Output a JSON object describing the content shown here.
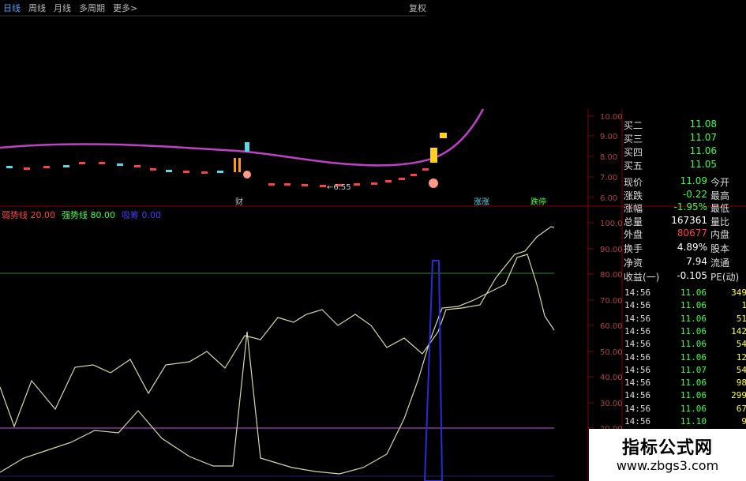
{
  "toolbar": {
    "tabs": [
      "日线",
      "周线",
      "月线",
      "多周期",
      "更多>"
    ],
    "active_tab": "日线",
    "restore_label": "复权"
  },
  "colors": {
    "ma_line": "#c040c8",
    "indicator_line": "#d8d8a8",
    "blue_spike": "#2a2ad8",
    "green_level": "#2a8a2a",
    "purple_level": "#a040c0",
    "axis_red": "#800000",
    "up": "#ff4040",
    "down": "#40ff40",
    "label_white": "#dddddd"
  },
  "price_axis": [
    "10.00",
    "9.00",
    "8.00",
    "7.00",
    "6.00"
  ],
  "indicator_axis": [
    "100.0",
    "90.00",
    "80.00",
    "70.00",
    "60.00",
    "50.00",
    "40.00",
    "30.00",
    "20.00"
  ],
  "price_marker": "6.55",
  "event_labels": [
    "财",
    "涨涨",
    "跌停"
  ],
  "legend": [
    {
      "label": "弱势线 20.00",
      "color": "#ff4040"
    },
    {
      "label": "强势线 80.00",
      "color": "#40ff40"
    },
    {
      "label": "吸筹 0.00",
      "color": "#4040ff"
    }
  ],
  "quote_panel": {
    "order_book": [
      {
        "label": "买二",
        "value": "11.08"
      },
      {
        "label": "买三",
        "value": "11.07"
      },
      {
        "label": "买四",
        "value": "11.06"
      },
      {
        "label": "买五",
        "value": "11.05"
      }
    ],
    "stats": [
      {
        "label": "现价",
        "value": "11.09",
        "label2": "今开",
        "color": "#40ff40"
      },
      {
        "label": "涨跌",
        "value": "-0.22",
        "label2": "最高",
        "color": "#40ff40"
      },
      {
        "label": "涨幅",
        "value": "-1.95%",
        "label2": "最低",
        "color": "#40ff40"
      },
      {
        "label": "总量",
        "value": "167361",
        "label2": "量比",
        "color": "#ffffff"
      },
      {
        "label": "外盘",
        "value": "80677",
        "label2": "内盘",
        "color": "#ff4040"
      }
    ],
    "stats2": [
      {
        "label": "换手",
        "value": "4.89%",
        "label2": "股本",
        "color": "#ffffff"
      },
      {
        "label": "净资",
        "value": "7.94",
        "label2": "流通",
        "color": "#ffffff"
      },
      {
        "label": "收益(一)",
        "value": "-0.105",
        "label2": "PE(动)",
        "color": "#ffffff"
      }
    ]
  },
  "ticks": [
    {
      "time": "14:56",
      "price": "11.06",
      "vol": "349"
    },
    {
      "time": "14:56",
      "price": "11.06",
      "vol": "1"
    },
    {
      "time": "14:56",
      "price": "11.06",
      "vol": "51"
    },
    {
      "time": "14:56",
      "price": "11.06",
      "vol": "142"
    },
    {
      "time": "14:56",
      "price": "11.06",
      "vol": "54"
    },
    {
      "time": "14:56",
      "price": "11.06",
      "vol": "12"
    },
    {
      "time": "14:56",
      "price": "11.07",
      "vol": "54"
    },
    {
      "time": "14:56",
      "price": "11.06",
      "vol": "98"
    },
    {
      "time": "14:56",
      "price": "11.06",
      "vol": "299"
    },
    {
      "time": "14:56",
      "price": "11.06",
      "vol": "67"
    },
    {
      "time": "14:56",
      "price": "11.10",
      "vol": "9"
    }
  ],
  "watermark": {
    "title": "指标公式网",
    "url": "www.zbgs3.com"
  }
}
